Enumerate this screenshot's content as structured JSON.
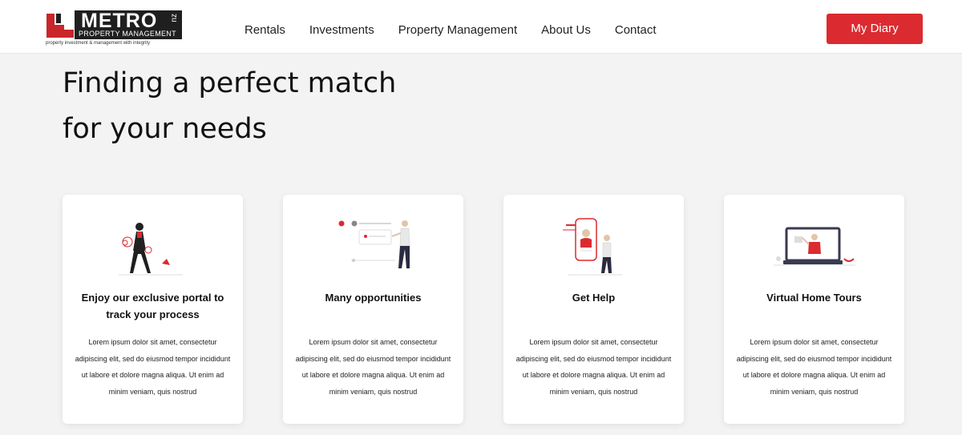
{
  "header": {
    "logo": {
      "brand": "METRO",
      "nz": "nz",
      "subtitle": "PROPERTY MANAGEMENT",
      "tagline": "property investment & management with integrity"
    },
    "nav": [
      "Rentals",
      "Investments",
      "Property Management",
      "About Us",
      "Contact"
    ],
    "cta_label": "My Diary"
  },
  "colors": {
    "accent": "#db2b30",
    "background": "#f3f3f3",
    "card": "#ffffff",
    "text": "#111111"
  },
  "hero": {
    "heading_line1": "Finding a perfect match",
    "heading_line2": "for your needs"
  },
  "cards": [
    {
      "icon": "portal-illustration",
      "title": "Enjoy our exclusive portal to track your process",
      "description": "Lorem ipsum dolor sit amet, consectetur adipiscing elit, sed do eiusmod tempor incididunt ut labore et dolore magna aliqua. Ut enim ad minim veniam, quis nostrud"
    },
    {
      "icon": "opportunities-illustration",
      "title": "Many opportunities",
      "description": "Lorem ipsum dolor sit amet, consectetur adipiscing elit, sed do eiusmod tempor incididunt ut labore et dolore magna aliqua. Ut enim ad minim veniam, quis nostrud"
    },
    {
      "icon": "help-illustration",
      "title": "Get Help",
      "description": "Lorem ipsum dolor sit amet, consectetur adipiscing elit, sed do eiusmod tempor incididunt ut labore et dolore magna aliqua. Ut enim ad minim veniam, quis nostrud"
    },
    {
      "icon": "virtual-tour-illustration",
      "title": "Virtual Home Tours",
      "description": "Lorem ipsum dolor sit amet, consectetur adipiscing elit, sed do eiusmod tempor incididunt ut labore et dolore magna aliqua. Ut enim ad minim veniam, quis nostrud"
    }
  ]
}
